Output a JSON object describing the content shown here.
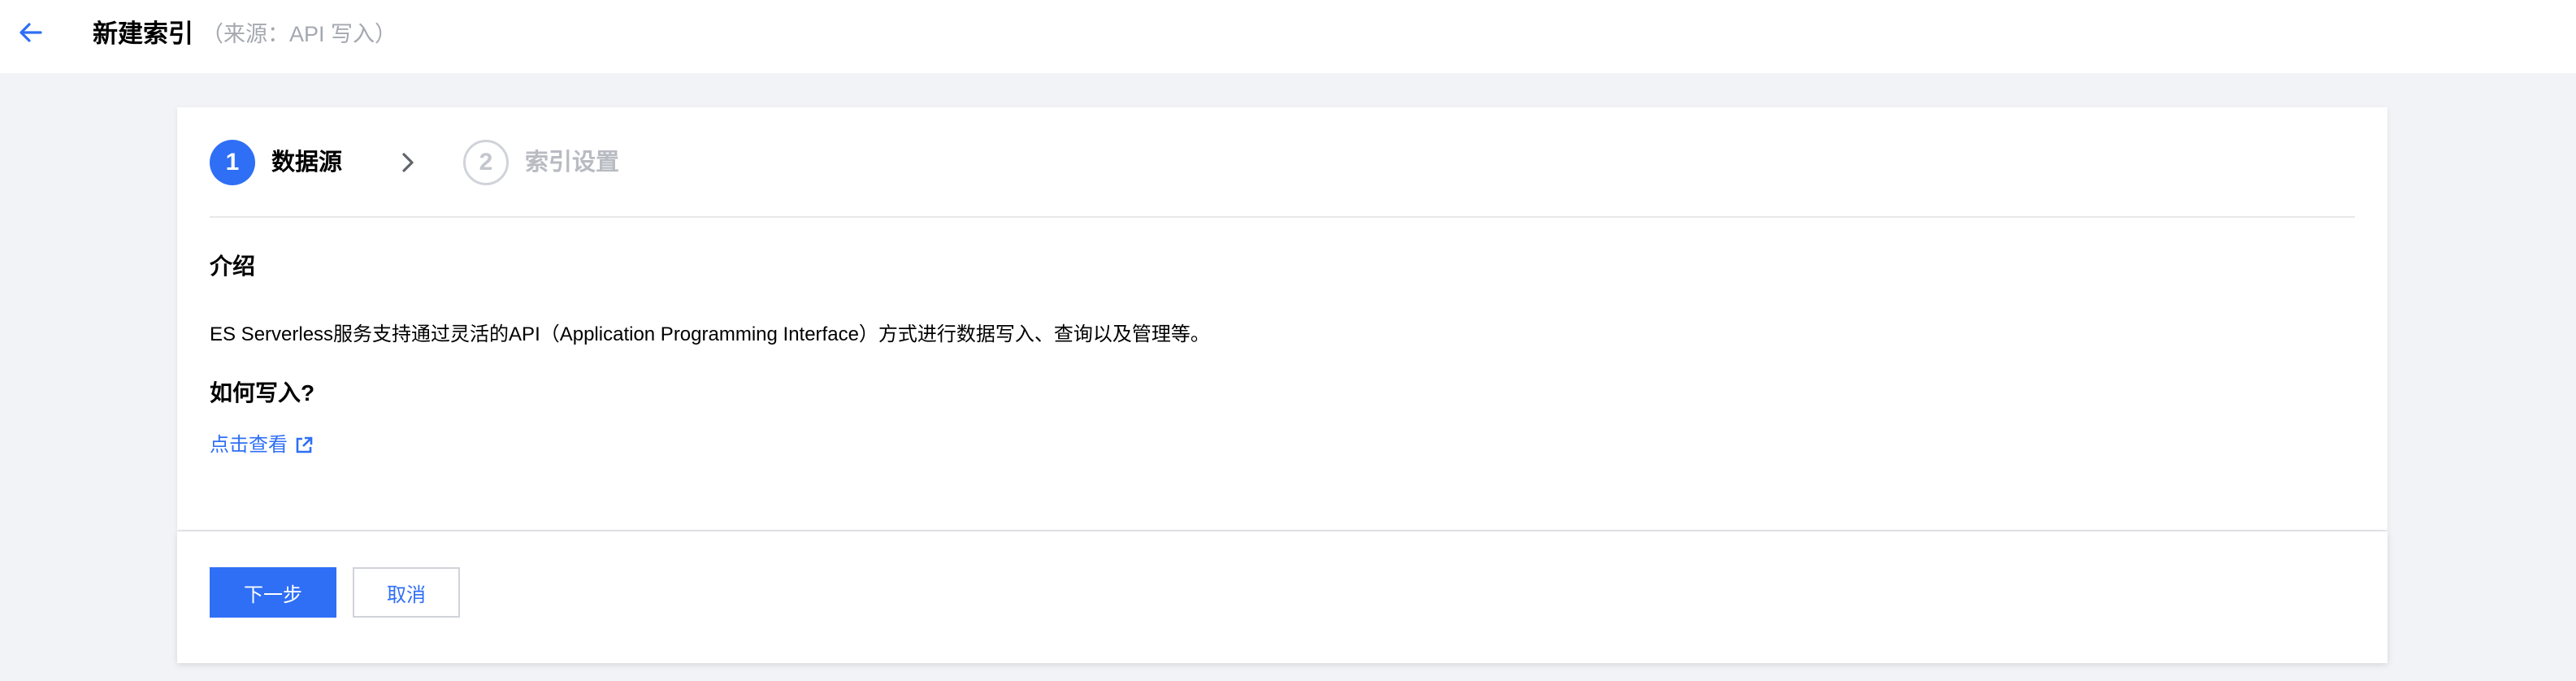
{
  "header": {
    "title": "新建索引",
    "subtitle": "（来源：API 写入）",
    "back_icon": "arrow-left-icon"
  },
  "steps": [
    {
      "number": "1",
      "label": "数据源",
      "state": "active"
    },
    {
      "number": "2",
      "label": "索引设置",
      "state": "inactive"
    }
  ],
  "intro": {
    "title": "介绍",
    "text": "ES Serverless服务支持通过灵活的API（Application Programming Interface）方式进行数据写入、查询以及管理等。"
  },
  "how_to_write": {
    "title": "如何写入?",
    "link_label": "点击查看",
    "link_icon": "external-link-icon"
  },
  "footer": {
    "next_label": "下一步",
    "cancel_label": "取消"
  },
  "colors": {
    "accent": "#2f6ff5",
    "background": "#f2f3f6",
    "muted": "#b8bbc2"
  }
}
